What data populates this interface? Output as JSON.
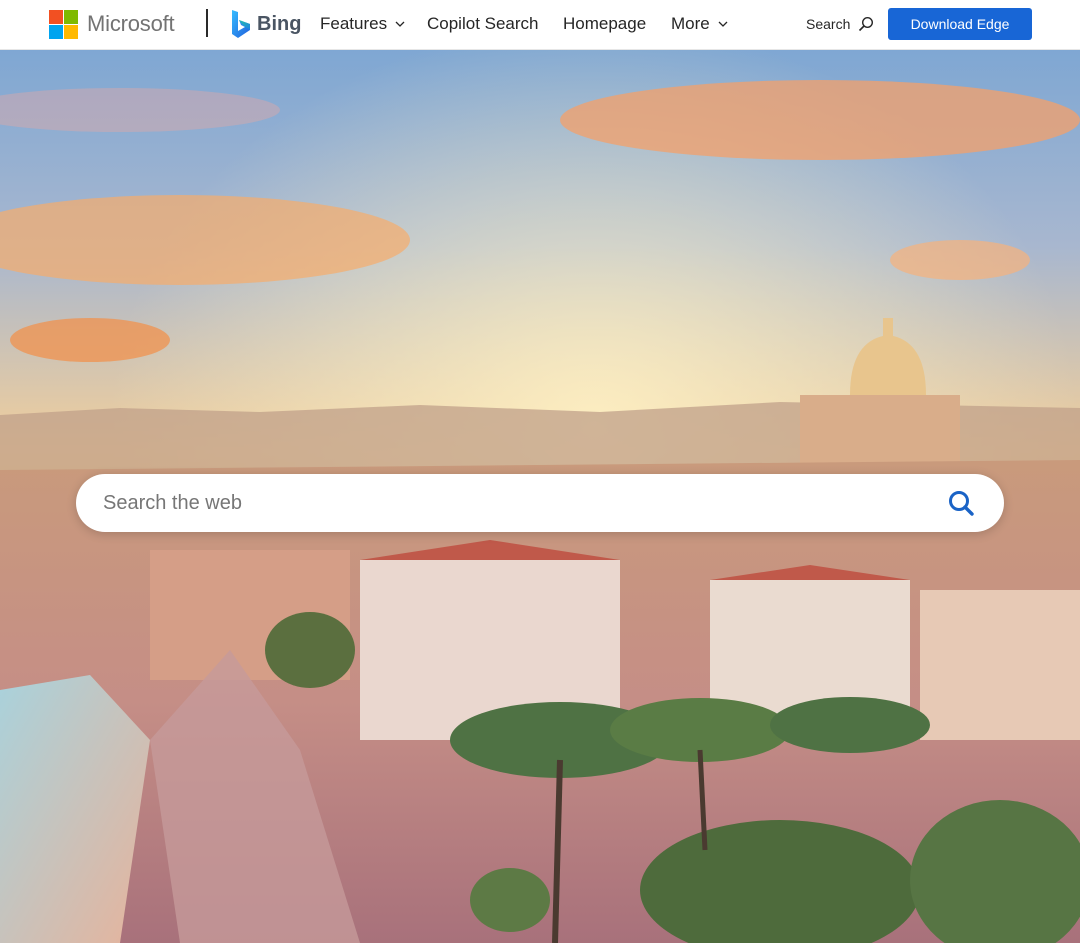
{
  "header": {
    "brand": "Microsoft",
    "product": "Bing",
    "nav": [
      {
        "label": "Features",
        "has_dropdown": true
      },
      {
        "label": "Copilot Search",
        "has_dropdown": false
      },
      {
        "label": "Homepage",
        "has_dropdown": false
      },
      {
        "label": "More",
        "has_dropdown": true
      }
    ],
    "search_label": "Search",
    "cta_label": "Download Edge"
  },
  "search": {
    "placeholder": "Search the web",
    "value": ""
  },
  "icons": {
    "logo": "microsoft-logo-icon",
    "bing": "bing-logo-icon",
    "dropdown": "chevron-down-icon",
    "search": "search-icon"
  },
  "colors": {
    "cta_bg": "#1866d6",
    "search_icon": "#1a63c6",
    "ms_red": "#f25022",
    "ms_green": "#7fba00",
    "ms_blue": "#00a4ef",
    "ms_yellow": "#ffb900"
  }
}
